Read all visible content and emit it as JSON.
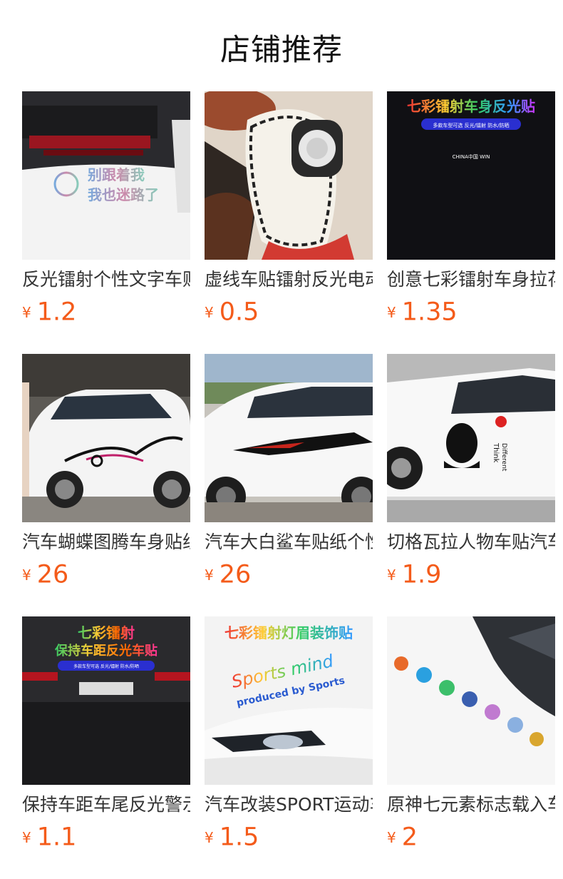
{
  "section": {
    "title": "店铺推荐"
  },
  "currency": "¥",
  "products": [
    {
      "name": "反光镭射个性文字车贴",
      "price": "1.2",
      "img_text": [
        "别跟着我",
        "我也迷路了"
      ]
    },
    {
      "name": "虚线车贴镭射反光电动车",
      "price": "0.5"
    },
    {
      "name": "创意七彩镭射车身拉花",
      "price": "1.35",
      "img_text": [
        "七彩镭射车身反光贴",
        "多款车型可选 反光/镭射 防水/防晒",
        "CHINA中国 WIN"
      ]
    },
    {
      "name": "汽车蝴蝶图腾车身贴纸",
      "price": "26"
    },
    {
      "name": "汽车大白鲨车贴纸个性",
      "price": "26"
    },
    {
      "name": "切格瓦拉人物车贴汽车",
      "price": "1.9",
      "img_text": [
        "Think",
        "Different"
      ]
    },
    {
      "name": "保持车距车尾反光警示",
      "price": "1.1",
      "img_text": [
        "七彩镭射",
        "保持车距反光车贴",
        "多款车型可选 反光/镭射 防水/防晒"
      ]
    },
    {
      "name": "汽车改装SPORT运动车贴",
      "price": "1.5",
      "img_text": [
        "七彩镭射灯眉装饰贴",
        "Sports mind",
        "produced by Sports"
      ]
    },
    {
      "name": "原神七元素标志载入车贴",
      "price": "2"
    }
  ]
}
